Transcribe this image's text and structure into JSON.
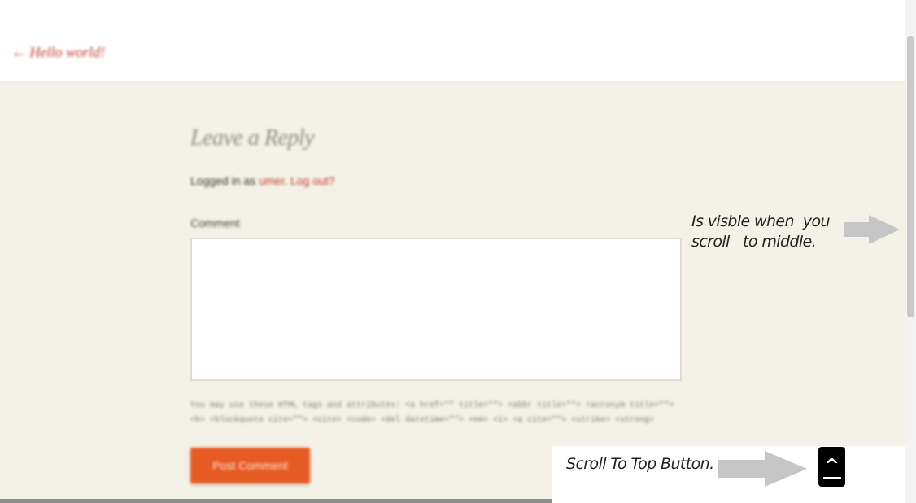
{
  "navigation": {
    "previous_post": "← Hello world!"
  },
  "comment_form": {
    "title": "Leave a Reply",
    "logged_in_prefix": "Logged in as ",
    "username": "umer",
    "logout_link": "Log out?",
    "comment_label": "Comment",
    "comment_value": "",
    "allowed_tags_text": "You may use these HTML tags and attributes: <a href=\"\" title=\"\"> <abbr title=\"\"> <acronym title=\"\"> <b> <blockquote cite=\"\"> <cite> <code> <del datetime=\"\"> <em> <i> <q cite=\"\"> <strike> <strong>",
    "submit_label": "Post Comment"
  },
  "annotations": {
    "scrollbar_note": "Is visble when  you\nscroll   to middle.",
    "button_note": "Scroll To Top Button."
  },
  "scroll_to_top": {
    "icon": "caret-up-icon",
    "glyph": "^"
  },
  "colors": {
    "background_cream": "#f4f2e6",
    "accent_orange": "#e65a23",
    "link_red": "#c0392b",
    "annotation_arrow": "#c6c6c6"
  }
}
